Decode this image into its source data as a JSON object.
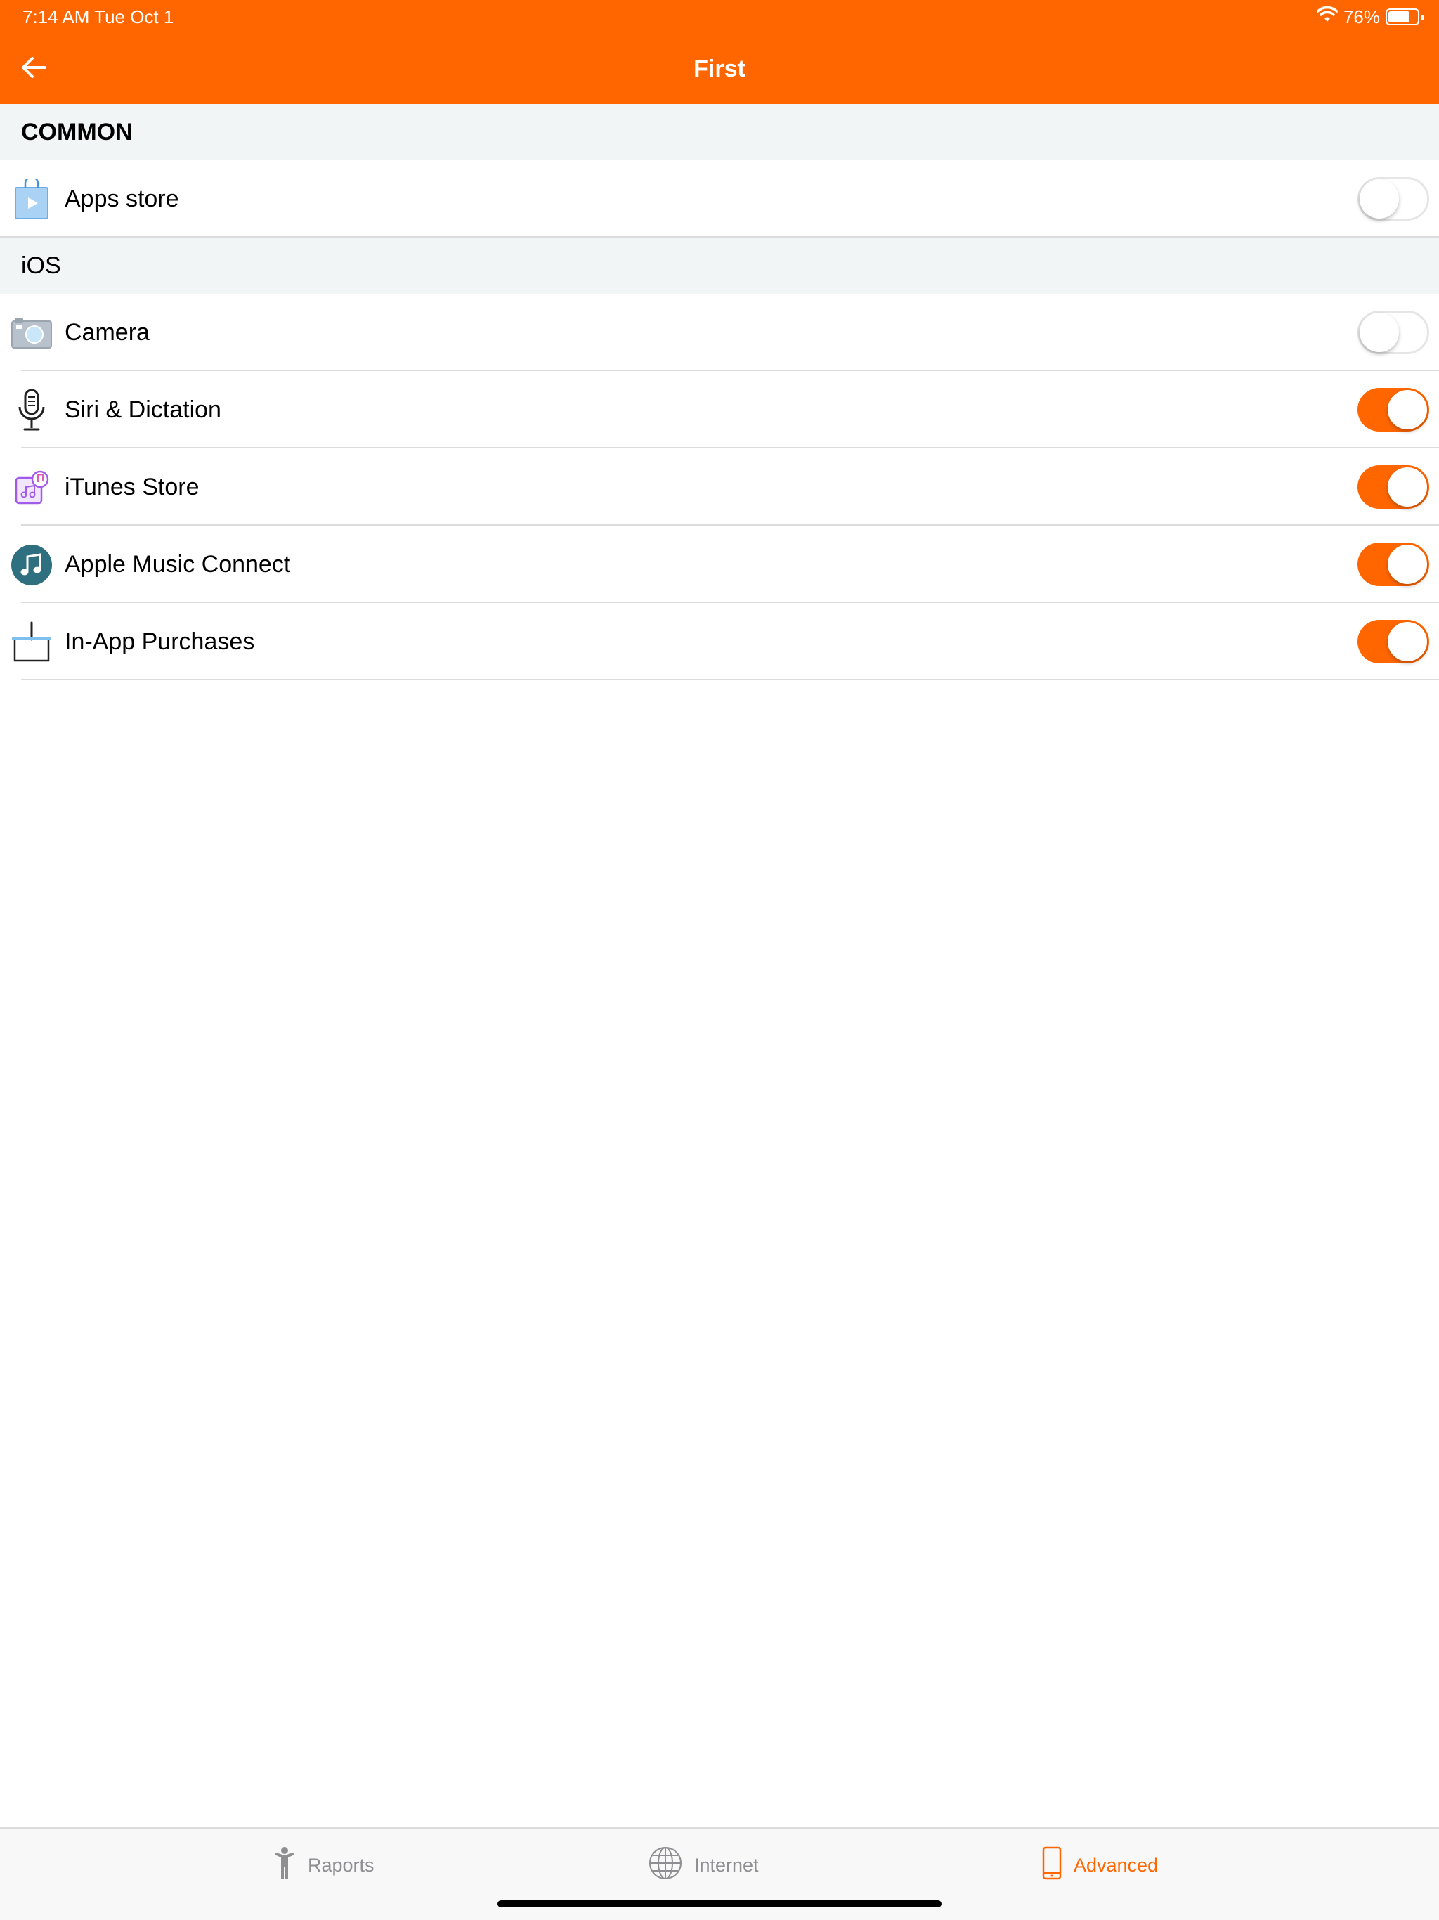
{
  "status_bar": {
    "time": "7:14 AM   Tue Oct 1",
    "battery": "76%",
    "battery_level": 0.76
  },
  "header": {
    "title": "First",
    "back_icon": "arrow-left-icon"
  },
  "sections": [
    {
      "title": "COMMON",
      "items": [
        {
          "label": "Apps store",
          "icon": "app-store-bag-icon",
          "enabled": false
        }
      ]
    },
    {
      "title": "iOS",
      "items": [
        {
          "label": "Camera",
          "icon": "camera-icon",
          "enabled": false
        },
        {
          "label": "Siri & Dictation",
          "icon": "microphone-icon",
          "enabled": true
        },
        {
          "label": "iTunes Store",
          "icon": "itunes-store-icon",
          "enabled": true
        },
        {
          "label": "Apple Music Connect",
          "icon": "music-note-icon",
          "enabled": true
        },
        {
          "label": "In-App Purchases",
          "icon": "basket-icon",
          "enabled": true
        }
      ]
    }
  ],
  "tab_bar": {
    "tabs": [
      {
        "label": "Raports",
        "icon": "person-icon",
        "active": false
      },
      {
        "label": "Internet",
        "icon": "globe-icon",
        "active": false
      },
      {
        "label": "Advanced",
        "icon": "phone-icon",
        "active": true
      }
    ]
  },
  "colors": {
    "accent": "#FF6600",
    "section_bg": "#F1F5F5",
    "separator": "#DCDCDC",
    "inactive_tab": "#8E8E93"
  }
}
